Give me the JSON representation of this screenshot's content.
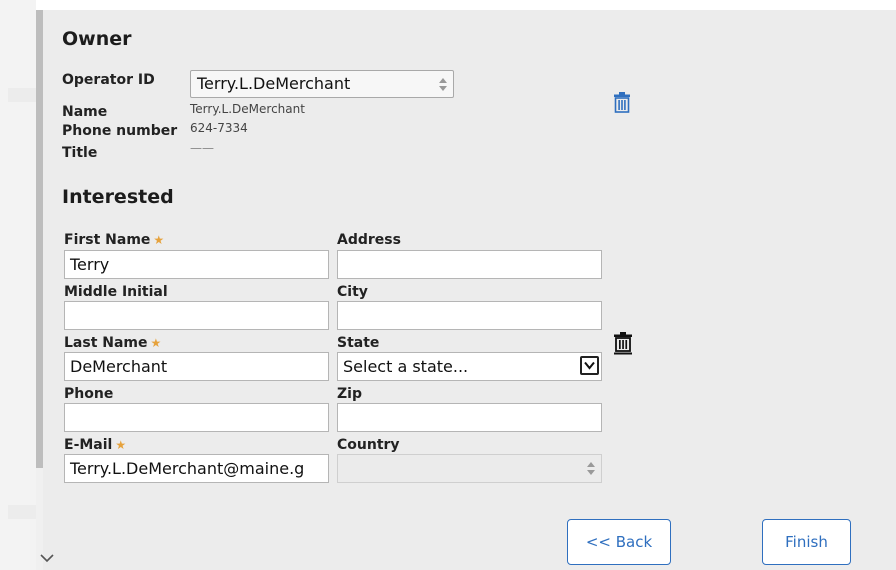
{
  "owner": {
    "heading": "Owner",
    "operator_label": "Operator ID",
    "operator_value": "Terry.L.DeMerchant",
    "name_label": "Name",
    "name_value": "Terry.L.DeMerchant",
    "phone_label": "Phone number",
    "phone_value": "624-7334",
    "title_label": "Title",
    "title_value": "——"
  },
  "interested": {
    "heading": "Interested",
    "first_name": {
      "label": "First Name",
      "value": "Terry",
      "required": "★"
    },
    "middle_initial": {
      "label": "Middle Initial",
      "value": ""
    },
    "last_name": {
      "label": "Last Name",
      "value": "DeMerchant",
      "required": "★"
    },
    "phone": {
      "label": "Phone",
      "value": ""
    },
    "email": {
      "label": "E-Mail",
      "value": "Terry.L.DeMerchant@maine.g",
      "required": "★"
    },
    "address": {
      "label": "Address",
      "value": ""
    },
    "city": {
      "label": "City",
      "value": ""
    },
    "state": {
      "label": "State",
      "value": "Select a state..."
    },
    "zip": {
      "label": "Zip",
      "value": ""
    },
    "country": {
      "label": "Country",
      "value": ""
    }
  },
  "buttons": {
    "back": "<< Back",
    "finish": "Finish"
  },
  "icons": {
    "trash_owner": "trash-icon",
    "trash_interested": "trash-icon",
    "scroll_down": "chevron-down-icon"
  },
  "colors": {
    "accent": "#2f6fbf",
    "required": "#e6a23c",
    "panel": "#ececec"
  }
}
